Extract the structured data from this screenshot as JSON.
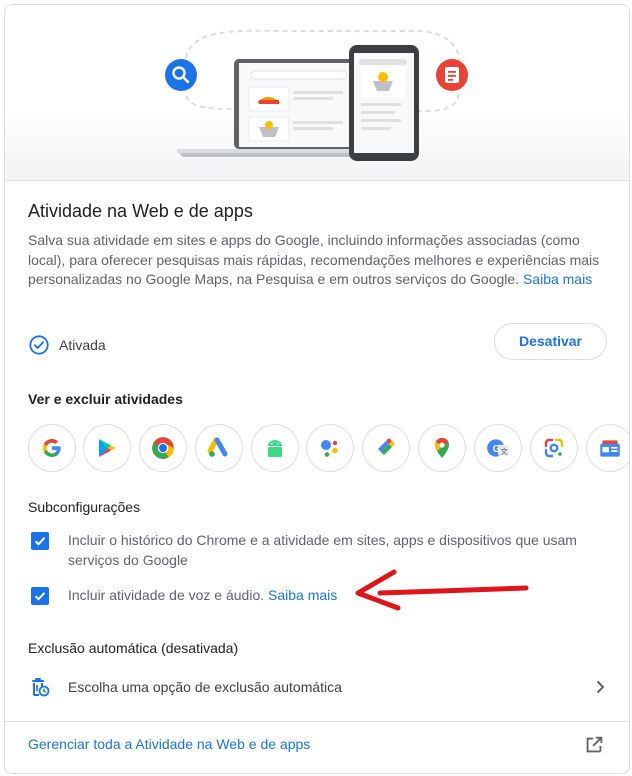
{
  "card": {
    "title": "Atividade na Web e de apps",
    "description": "Salva sua atividade em sites e apps do Google, incluindo informações associadas (como local), para oferecer pesquisas mais rápidas, recomendações melhores e experiências mais personalizadas no Google Maps, na Pesquisa e em outros serviços do Google.",
    "learn_more": "Saiba mais",
    "status": "Ativada",
    "deactivate_label": "Desativar"
  },
  "activities": {
    "heading": "Ver e excluir atividades",
    "apps": [
      "google-search-icon",
      "google-play-icon",
      "chrome-icon",
      "google-ads-icon",
      "android-icon",
      "google-assistant-icon",
      "google-pay-icon",
      "google-maps-icon",
      "google-translate-icon",
      "google-lens-icon",
      "google-news-icon"
    ]
  },
  "subsettings": {
    "heading": "Subconfigurações",
    "items": [
      {
        "label": "Incluir o histórico do Chrome e a atividade em sites, apps e dispositivos que usam serviços do Google",
        "checked": true
      },
      {
        "label": "Incluir atividade de voz e áudio.",
        "link": "Saiba mais",
        "checked": true
      }
    ]
  },
  "auto_delete": {
    "heading": "Exclusão automática (desativada)",
    "option_label": "Escolha uma opção de exclusão automática"
  },
  "footer": {
    "manage_label": "Gerenciar toda a Atividade na Web e de apps"
  },
  "colors": {
    "accent": "#1a73e8",
    "annotation_arrow": "#e0151b"
  }
}
